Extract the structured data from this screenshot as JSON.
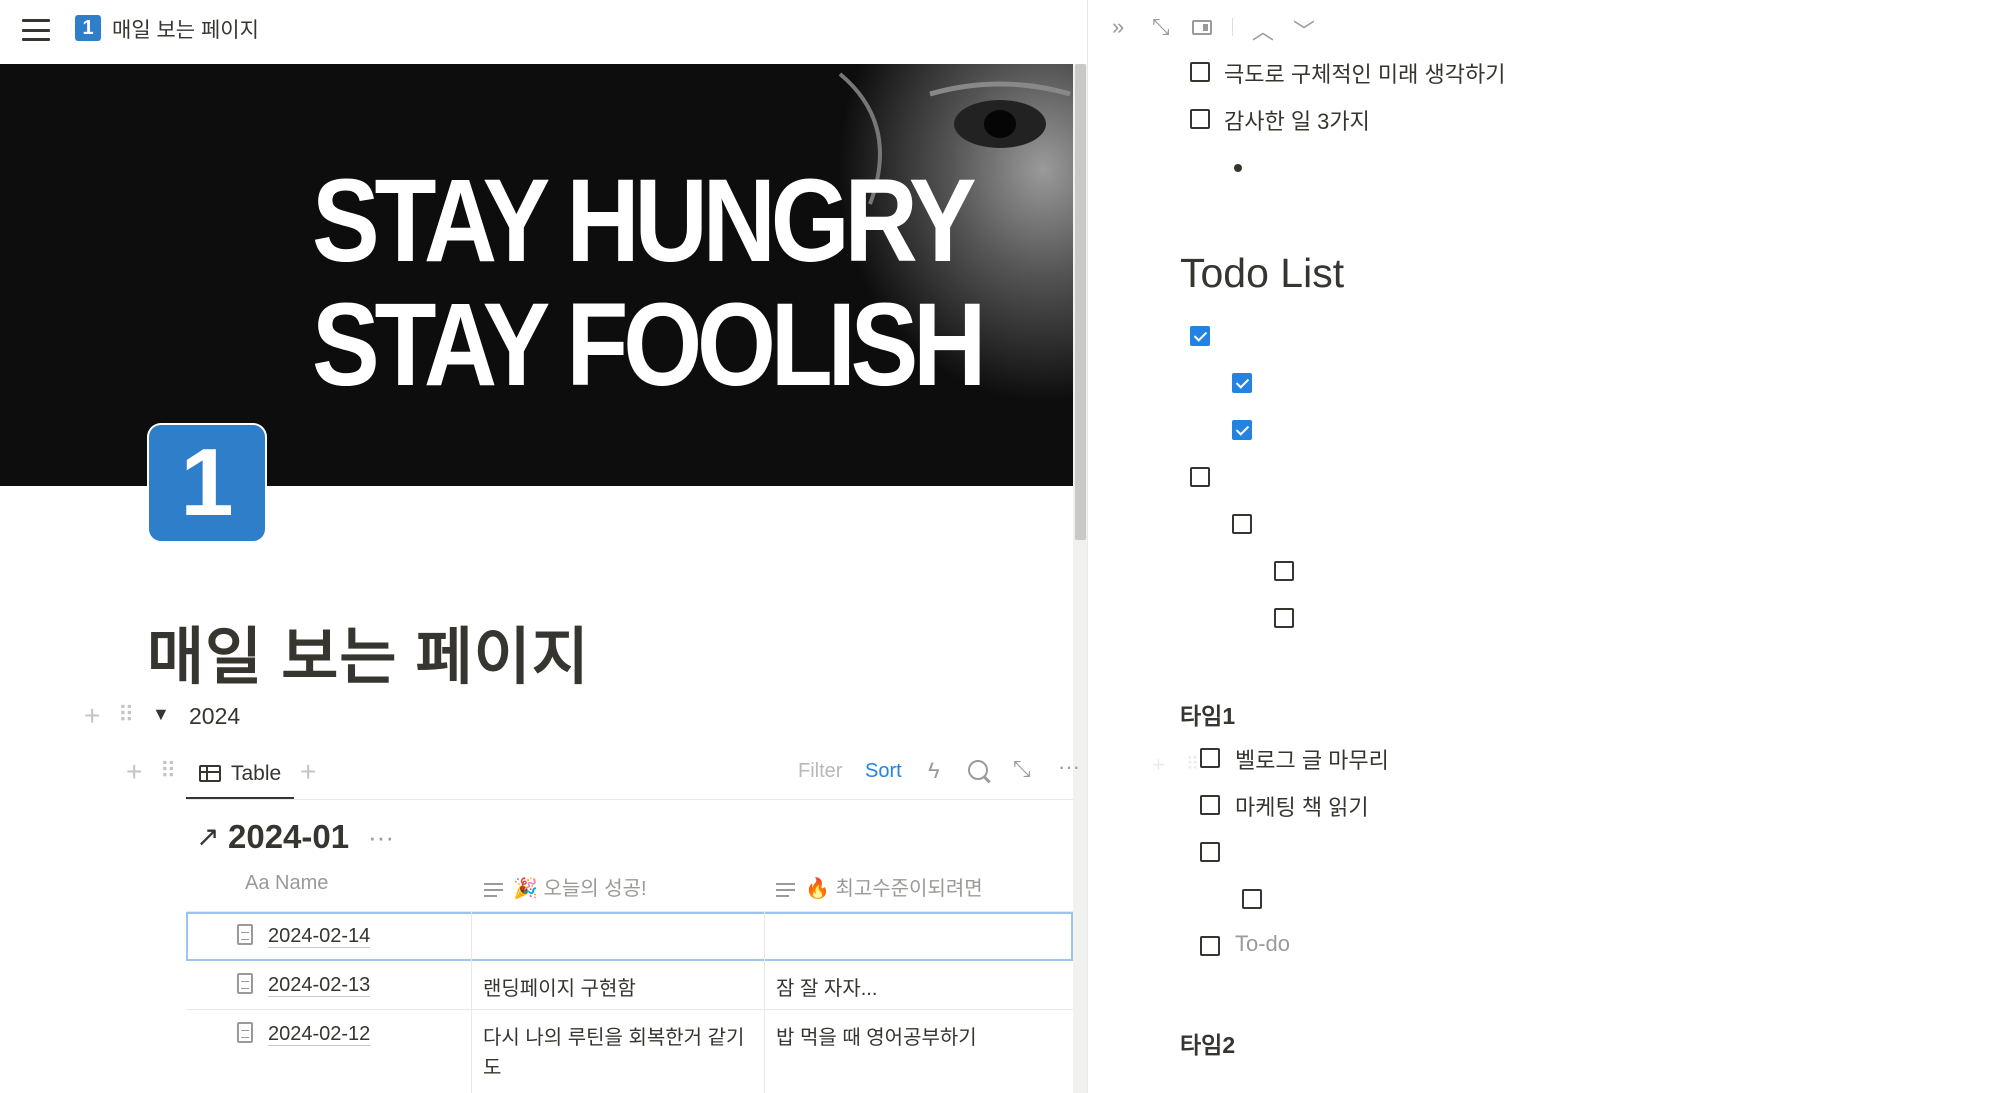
{
  "topbar": {
    "page_icon": "1",
    "breadcrumb": "매일 보는 페이지"
  },
  "cover": {
    "line1": "STAY HUNGRY",
    "line2": "STAY FOOLISH"
  },
  "page": {
    "icon": "1",
    "title": "매일 보는 페이지"
  },
  "toggle": {
    "label": "2024"
  },
  "database": {
    "view_label": "Table",
    "filter_label": "Filter",
    "sort_label": "Sort",
    "group_title": "2024-01",
    "group_more": "···",
    "columns": [
      {
        "label": "Aa Name"
      },
      {
        "label": "🎉 오늘의 성공!"
      },
      {
        "label": "🔥 최고수준이되려면"
      }
    ],
    "rows": [
      {
        "name": "2024-02-14",
        "success": "",
        "top": ""
      },
      {
        "name": "2024-02-13",
        "success": "랜딩페이지 구현함",
        "top": "잠 잘 자자..."
      },
      {
        "name": "2024-02-12",
        "success": "다시 나의 루틴을 회복한거 같기도",
        "top": "밥 먹을 때 영어공부하기"
      }
    ]
  },
  "side_peek": {
    "todos_top": [
      {
        "text": "극도로 구체적인 미래 생각하기",
        "checked": false
      },
      {
        "text": "감사한 일 3가지",
        "checked": false
      }
    ],
    "todo_heading": "Todo List",
    "todo_items": [
      {
        "text": "",
        "checked": true
      },
      {
        "text": "",
        "checked": true
      },
      {
        "text": "",
        "checked": true
      },
      {
        "text": "",
        "checked": false
      },
      {
        "text": "",
        "checked": false
      },
      {
        "text": "",
        "checked": false
      },
      {
        "text": "",
        "checked": false
      }
    ],
    "time1_heading": "타임1",
    "time1_items": [
      {
        "text": "벨로그 글 마무리",
        "checked": false
      },
      {
        "text": "마케팅 책 읽기",
        "checked": false
      },
      {
        "text": "",
        "checked": false
      },
      {
        "text": "",
        "checked": false
      },
      {
        "text": "To-do",
        "checked": false,
        "placeholder": true
      }
    ],
    "time2_heading": "타임2"
  },
  "colors": {
    "accent_blue": "#2383e2",
    "page_icon_blue": "#2f7ec9",
    "text": "#37352f",
    "muted": "#9b9a97"
  }
}
